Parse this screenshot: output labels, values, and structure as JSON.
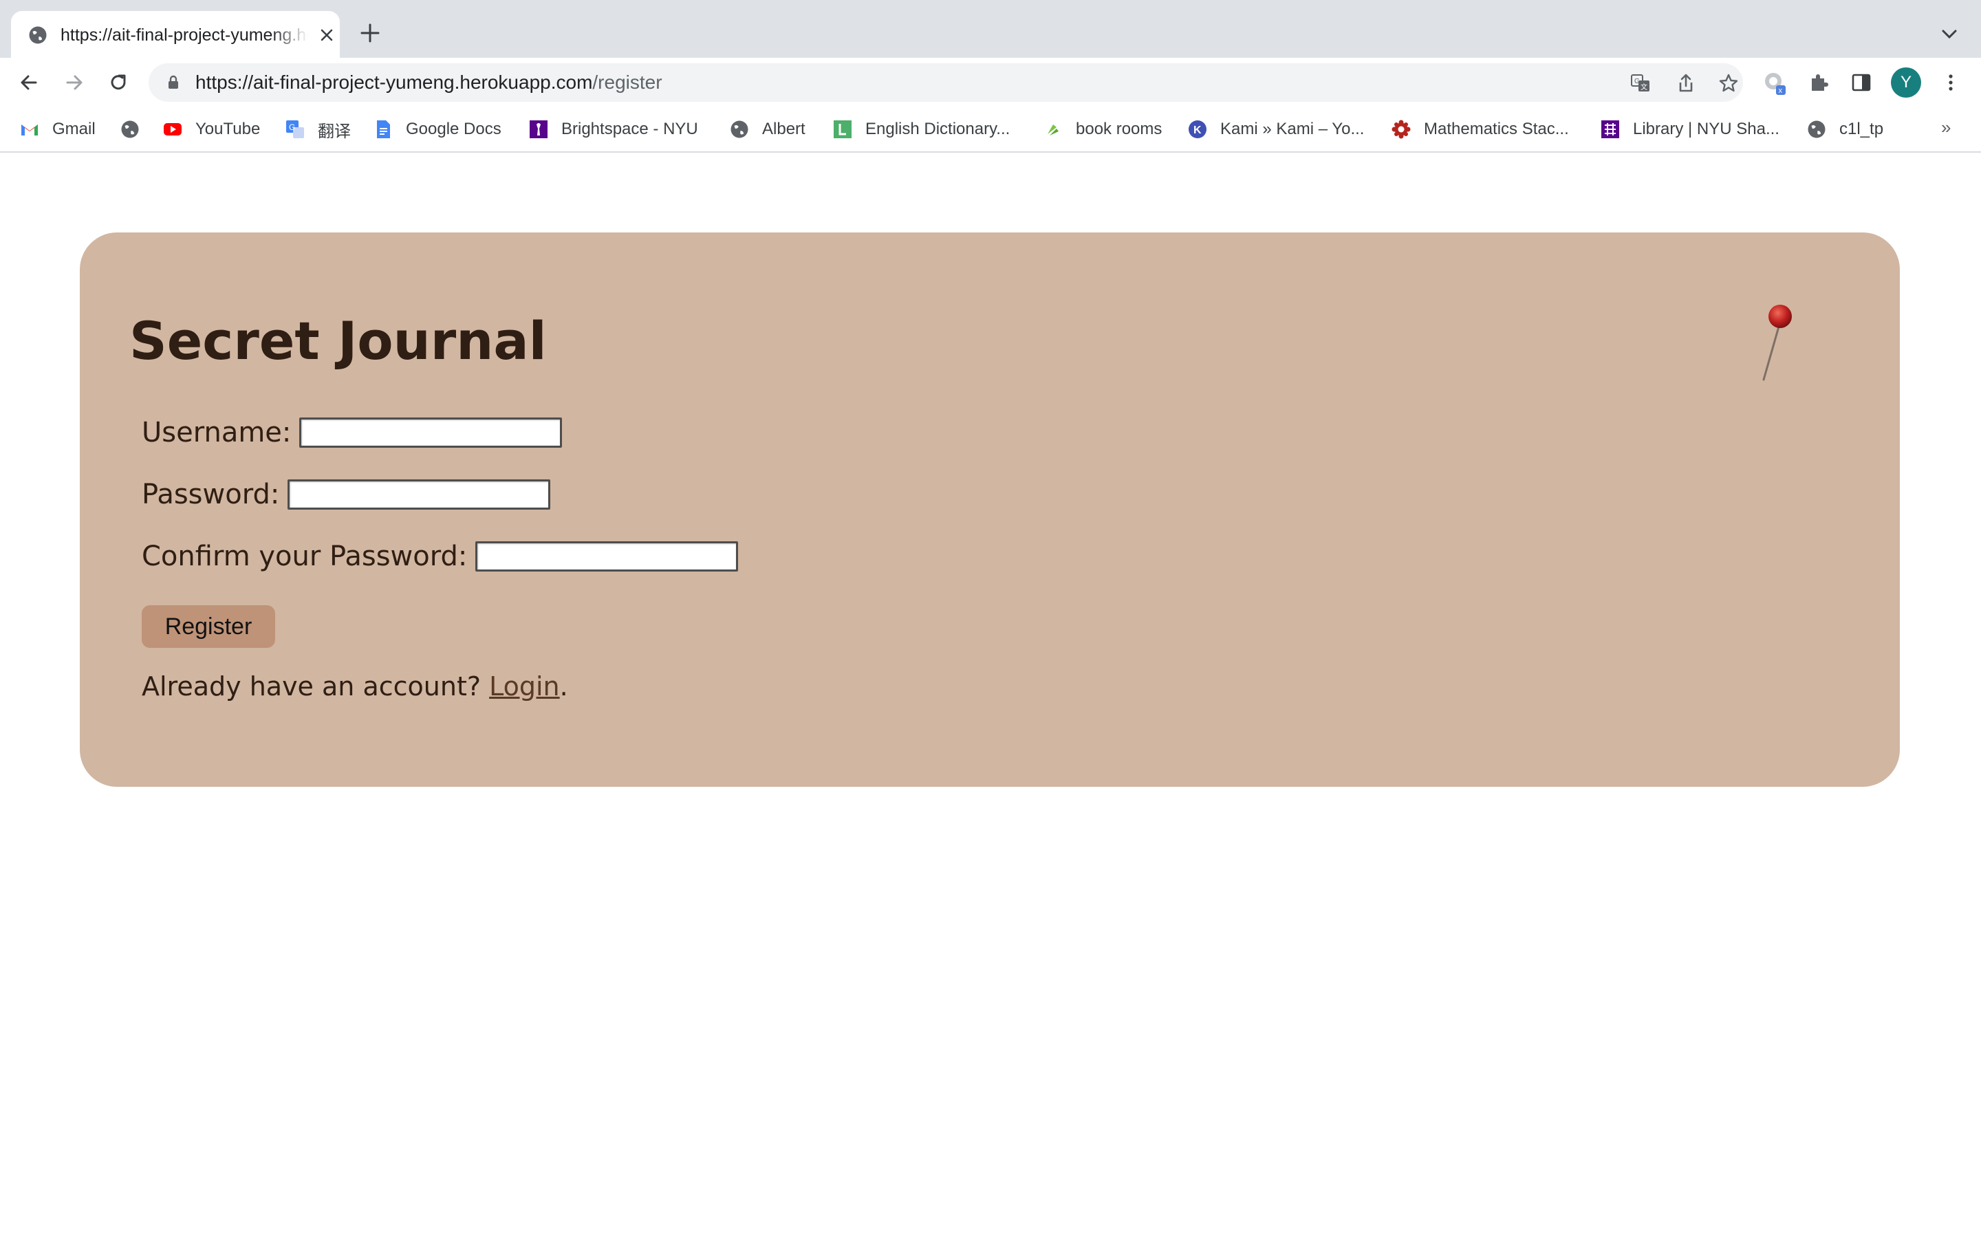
{
  "browser": {
    "tab": {
      "title": "https://ait-final-project-yumeng.herokuapp.com/register"
    },
    "address_bar": {
      "url_host": "https://ait-final-project-yumeng.herokuapp.com",
      "url_path": "/register"
    },
    "profile_initial": "Y",
    "bookmarks": [
      {
        "label": "Gmail",
        "icon": "gmail-icon"
      },
      {
        "label": "",
        "icon": "globe-icon"
      },
      {
        "label": "YouTube",
        "icon": "youtube-icon"
      },
      {
        "label": "翻译",
        "icon": "google-translate-icon"
      },
      {
        "label": "Google Docs",
        "icon": "google-docs-icon"
      },
      {
        "label": "Brightspace - NYU",
        "icon": "nyu-torch-icon"
      },
      {
        "label": "Albert",
        "icon": "globe-icon"
      },
      {
        "label": "English Dictionary...",
        "icon": "dictionary-l-icon"
      },
      {
        "label": "book rooms",
        "icon": "leaf-icon"
      },
      {
        "label": "Kami » Kami – Yo...",
        "icon": "kami-icon"
      },
      {
        "label": "Mathematics Stac...",
        "icon": "math-stackexchange-icon"
      },
      {
        "label": "Library | NYU Sha...",
        "icon": "library-icon"
      },
      {
        "label": "c1l_tp",
        "icon": "globe-icon"
      }
    ],
    "bookmarks_overflow": "»"
  },
  "page": {
    "title": "Secret Journal",
    "form": {
      "username_label": "Username:",
      "password_label": "Password:",
      "confirm_label": "Confirm your Password:",
      "submit_label": "Register"
    },
    "footer": {
      "prefix": "Already have an account? ",
      "link": "Login",
      "suffix": "."
    }
  },
  "colors": {
    "card_background": "#d1b6a1",
    "button_background": "#bf9378",
    "text": "#2f1e13",
    "pin": "#c0201f"
  }
}
